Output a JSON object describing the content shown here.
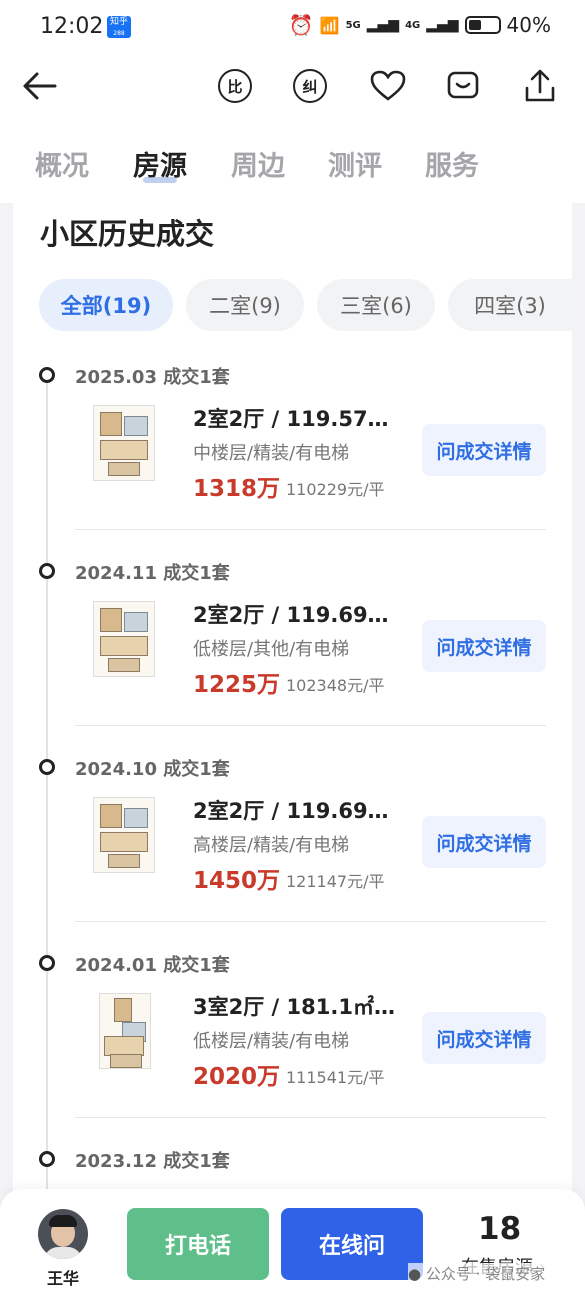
{
  "status_bar": {
    "time": "12:02",
    "app_badge": "知乎",
    "app_badge_sub": "288",
    "signal_6": "6",
    "signal_5g": "5G",
    "signal_4g": "4G",
    "battery": "40%"
  },
  "nav": {
    "compare_icon_label": "比",
    "correct_icon_label": "纠"
  },
  "tabs": [
    {
      "label": "概况",
      "active": false
    },
    {
      "label": "房源",
      "active": true
    },
    {
      "label": "周边",
      "active": false
    },
    {
      "label": "测评",
      "active": false
    },
    {
      "label": "服务",
      "active": false
    }
  ],
  "section": {
    "title": "小区历史成交"
  },
  "filters": [
    {
      "label": "全部(19)",
      "active": true
    },
    {
      "label": "二室(9)",
      "active": false
    },
    {
      "label": "三室(6)",
      "active": false
    },
    {
      "label": "四室(3)",
      "active": false
    }
  ],
  "transactions": [
    {
      "date": "2025.03 成交1套",
      "title": "2室2厅 / 119.57…",
      "sub": "中楼层/精装/有电梯",
      "price": "1318万",
      "unit_price": "110229元/平",
      "button": "问成交详情"
    },
    {
      "date": "2024.11 成交1套",
      "title": "2室2厅 / 119.69…",
      "sub": "低楼层/其他/有电梯",
      "price": "1225万",
      "unit_price": "102348元/平",
      "button": "问成交详情"
    },
    {
      "date": "2024.10 成交1套",
      "title": "2室2厅 / 119.69…",
      "sub": "高楼层/精装/有电梯",
      "price": "1450万",
      "unit_price": "121147元/平",
      "button": "问成交详情"
    },
    {
      "date": "2024.01 成交1套",
      "title": "3室2厅 / 181.1㎡…",
      "sub": "低楼层/精装/有电梯",
      "price": "2020万",
      "unit_price": "111541元/平",
      "button": "问成交详情"
    },
    {
      "date": "2023.12 成交1套"
    }
  ],
  "bottom": {
    "agent_name": "王华",
    "call_label": "打电话",
    "ask_label": "在线问",
    "listing_count": "18",
    "listing_label": "在售房源",
    "watermark": "公众号 · 袋鼠安家"
  },
  "colors": {
    "accent_blue": "#2f62e6",
    "price_red": "#c93a2b",
    "call_green": "#5fbf8a"
  }
}
